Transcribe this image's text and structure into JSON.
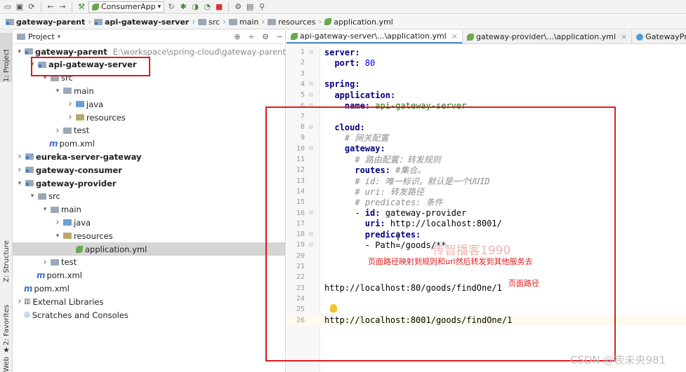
{
  "toolbar": {
    "run_config": "ConsumerApp"
  },
  "breadcrumb": [
    {
      "label": "gateway-parent",
      "bold": true,
      "icon": "module-folder-icon"
    },
    {
      "label": "api-gateway-server",
      "bold": true,
      "icon": "module-folder-icon"
    },
    {
      "label": "src",
      "bold": false,
      "icon": "folder-icon"
    },
    {
      "label": "main",
      "bold": false,
      "icon": "folder-icon"
    },
    {
      "label": "resources",
      "bold": false,
      "icon": "resources-folder-icon"
    },
    {
      "label": "application.yml",
      "bold": false,
      "icon": "spring-leaf-icon"
    }
  ],
  "left_strip": {
    "project_tab": "1: Project",
    "structure_tab": "Z: Structure",
    "favorites_tab": "2: Favorites",
    "web_tab": "Web"
  },
  "project_panel": {
    "title": "Project",
    "tree": [
      {
        "label": "gateway-parent",
        "hint": "E:\\workspace\\spring-cloud\\gateway-parent",
        "bold": true,
        "arrow": "down",
        "icon": "module"
      },
      {
        "label": "api-gateway-server",
        "bold": true,
        "arrow": "down",
        "icon": "module"
      },
      {
        "label": "src",
        "arrow": "down",
        "icon": "folder"
      },
      {
        "label": "main",
        "arrow": "down",
        "icon": "folder"
      },
      {
        "label": "java",
        "arrow": "right",
        "icon": "folder-blue"
      },
      {
        "label": "resources",
        "arrow": "right",
        "icon": "resources"
      },
      {
        "label": "test",
        "arrow": "right",
        "icon": "folder"
      },
      {
        "label": "pom.xml",
        "arrow": "none",
        "icon": "maven"
      },
      {
        "label": "eureka-server-gateway",
        "bold": true,
        "arrow": "right",
        "icon": "module"
      },
      {
        "label": "gateway-consumer",
        "bold": true,
        "arrow": "right",
        "icon": "module"
      },
      {
        "label": "gateway-provider",
        "bold": true,
        "arrow": "down",
        "icon": "module"
      },
      {
        "label": "src",
        "arrow": "down",
        "icon": "folder"
      },
      {
        "label": "main",
        "arrow": "down",
        "icon": "folder"
      },
      {
        "label": "java",
        "arrow": "right",
        "icon": "folder-blue"
      },
      {
        "label": "resources",
        "arrow": "down",
        "icon": "resources"
      },
      {
        "label": "application.yml",
        "arrow": "none",
        "icon": "spring",
        "selected": true
      },
      {
        "label": "test",
        "arrow": "right",
        "icon": "folder"
      },
      {
        "label": "pom.xml",
        "arrow": "none",
        "icon": "maven"
      },
      {
        "label": "pom.xml",
        "arrow": "none",
        "icon": "maven"
      },
      {
        "label": "External Libraries",
        "arrow": "right",
        "icon": "library"
      },
      {
        "label": "Scratches and Consoles",
        "arrow": "none",
        "icon": "scratch"
      }
    ]
  },
  "editor": {
    "tabs": [
      {
        "label": "api-gateway-server\\...\\application.yml",
        "active": true
      },
      {
        "label": "gateway-provider\\...\\application.yml",
        "active": false
      },
      {
        "label": "GatewayPrope",
        "active": false
      }
    ],
    "lines": [
      {
        "n": "1",
        "parts": [
          [
            "k",
            "server:"
          ]
        ]
      },
      {
        "n": "2",
        "parts": [
          [
            "k",
            "  port: "
          ],
          [
            "num",
            "80"
          ]
        ]
      },
      {
        "n": "3",
        "parts": []
      },
      {
        "n": "4",
        "parts": [
          [
            "k",
            "spring:"
          ]
        ]
      },
      {
        "n": "5",
        "parts": [
          [
            "k",
            "  application:"
          ]
        ]
      },
      {
        "n": "6",
        "parts": [
          [
            "k",
            "    name: "
          ],
          [
            "v",
            "api-gateway-server"
          ]
        ]
      },
      {
        "n": "7",
        "parts": []
      },
      {
        "n": "8",
        "parts": [
          [
            "k",
            "  cloud:"
          ]
        ]
      },
      {
        "n": "9",
        "parts": [
          [
            "cm",
            "    # 网关配置"
          ]
        ]
      },
      {
        "n": "10",
        "parts": [
          [
            "k",
            "    gateway:"
          ]
        ]
      },
      {
        "n": "11",
        "parts": [
          [
            "cm",
            "      # 路由配置：转发规则"
          ]
        ]
      },
      {
        "n": "12",
        "parts": [
          [
            "k",
            "      routes: "
          ],
          [
            "cm",
            "#集合。"
          ]
        ]
      },
      {
        "n": "13",
        "parts": [
          [
            "cm",
            "      # id: 唯一标识。默认是一个UUID"
          ]
        ]
      },
      {
        "n": "14",
        "parts": [
          [
            "cm",
            "      # uri: 转发路径"
          ]
        ]
      },
      {
        "n": "15",
        "parts": [
          [
            "cm",
            "      # predicates: 条件"
          ]
        ]
      },
      {
        "n": "16",
        "parts": [
          [
            "plain",
            "      - "
          ],
          [
            "k",
            "id: "
          ],
          [
            "plain",
            "gateway-provider"
          ]
        ]
      },
      {
        "n": "17",
        "parts": [
          [
            "k",
            "        uri: "
          ],
          [
            "plain",
            "http://localhost:8001/"
          ]
        ]
      },
      {
        "n": "18",
        "parts": [
          [
            "k",
            "        predicates:"
          ]
        ]
      },
      {
        "n": "19",
        "parts": [
          [
            "plain",
            "        - Path=/goods/**"
          ]
        ]
      },
      {
        "n": "20",
        "parts": []
      },
      {
        "n": "21",
        "parts": []
      },
      {
        "n": "22",
        "parts": []
      },
      {
        "n": "23",
        "parts": [
          [
            "plain",
            "http://localhost:80/goods/findOne/1"
          ]
        ]
      },
      {
        "n": "24",
        "parts": []
      },
      {
        "n": "25",
        "parts": []
      },
      {
        "n": "26",
        "parts": [
          [
            "plain",
            "http://localhost:8001/goods/findOne/1"
          ]
        ],
        "current": true
      }
    ]
  },
  "annotations": {
    "mapping_note": "页面路径映射到规则和url然后转发到其他服务去",
    "path_note": "页面路径",
    "watermark": "传智播客1990",
    "csdn_mark": "CSDN @夜未央981"
  },
  "colors": {
    "annotation_red": "#e01a1a",
    "yaml_key": "#000080",
    "yaml_value": "#067d17",
    "yaml_comment": "#8c8c8c"
  }
}
